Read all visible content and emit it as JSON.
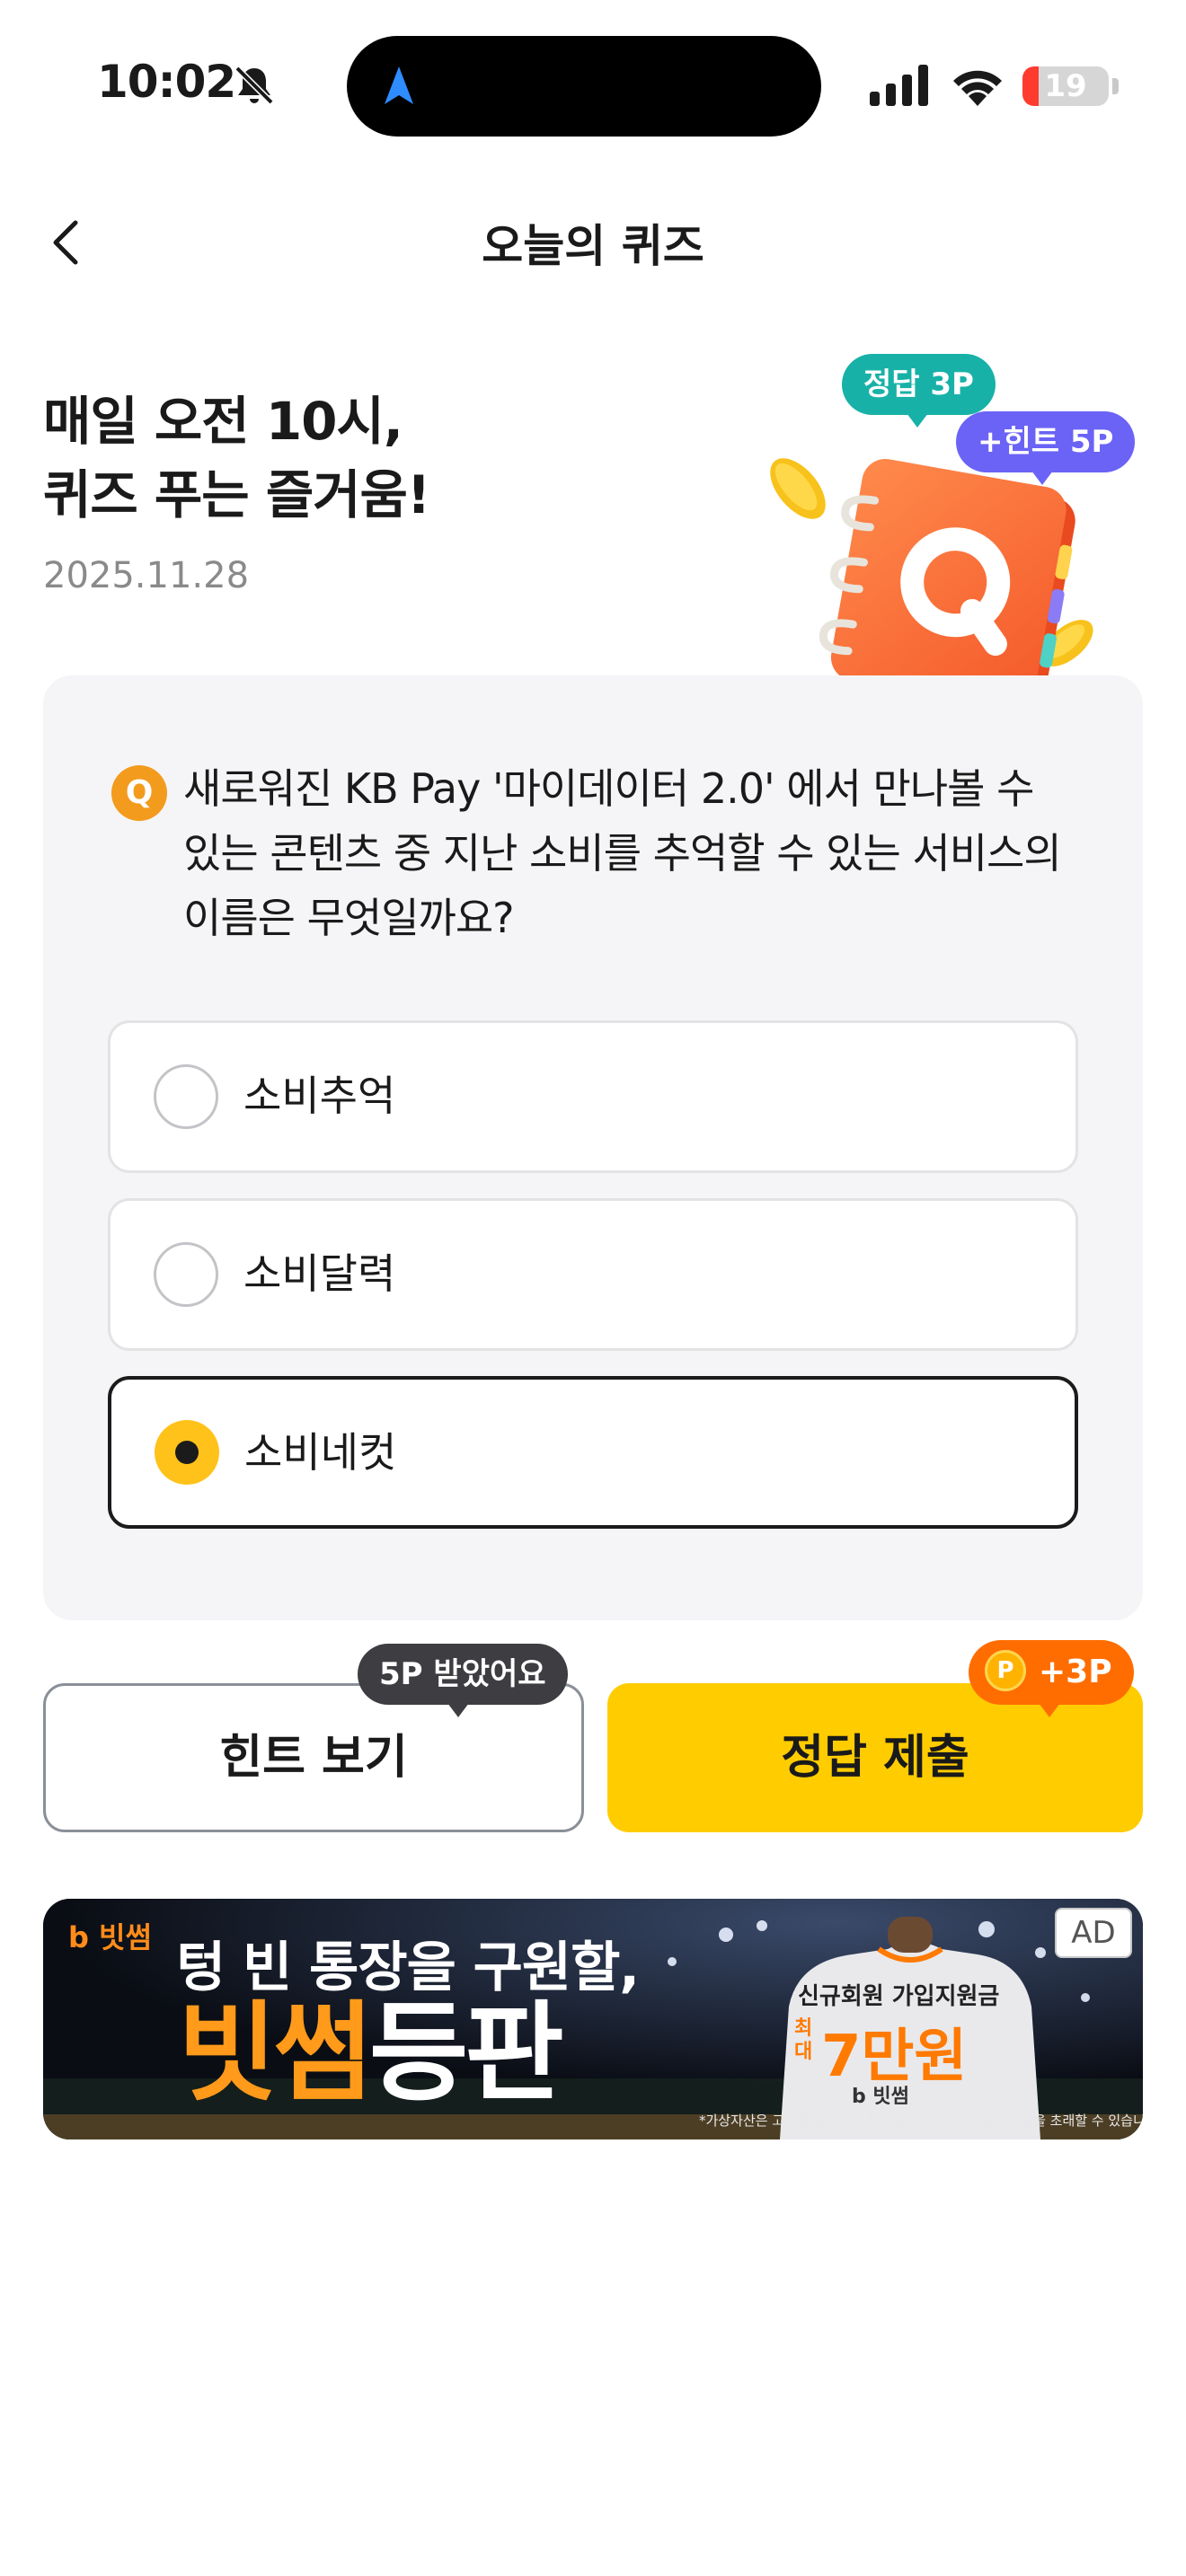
{
  "status_bar": {
    "time": "10:02",
    "battery": "19"
  },
  "header": {
    "title": "오늘의 퀴즈"
  },
  "intro": {
    "title_line1": "매일 오전 10시,",
    "title_line2": "퀴즈 푸는 즐거움!",
    "date": "2025.11.28",
    "bubble_answer": "정답 3P",
    "bubble_hint": "+힌트 5P"
  },
  "quiz": {
    "badge": "Q",
    "question": "새로워진 KB Pay '마이데이터 2.0' 에서 만나볼 수 있는 콘텐츠 중 지난 소비를 추억할 수 있는 서비스의 이름은 무엇일까요?",
    "options": [
      {
        "label": "소비추억",
        "selected": false
      },
      {
        "label": "소비달력",
        "selected": false
      },
      {
        "label": "소비네컷",
        "selected": true
      }
    ]
  },
  "actions": {
    "hint_label": "힌트 보기",
    "hint_tooltip": "5P 받았어요",
    "submit_label": "정답 제출",
    "submit_tooltip": "+3P",
    "coin_symbol": "P"
  },
  "ad": {
    "logo": "b 빗썸",
    "headline": "텅 빈 통장을 구원할,",
    "brand_part1": "빗썸",
    "brand_part2": "등판",
    "jersey_top": "신규회원 가입지원금",
    "jersey_max": "최대",
    "jersey_amount": "7만원",
    "jersey_brand": "b 빗썸",
    "disclaimer": "*가상자산은 고위험 상품으로 투자금의 전부 또는 일부 손실을 초래할 수 있습니다.",
    "tag": "AD"
  },
  "colors": {
    "accent_yellow": "#ffcc00",
    "answer_bubble": "#18b1a8",
    "hint_bubble": "#6a63f6",
    "reward_orange": "#ff6d00",
    "q_badge": "#f39b1d"
  }
}
